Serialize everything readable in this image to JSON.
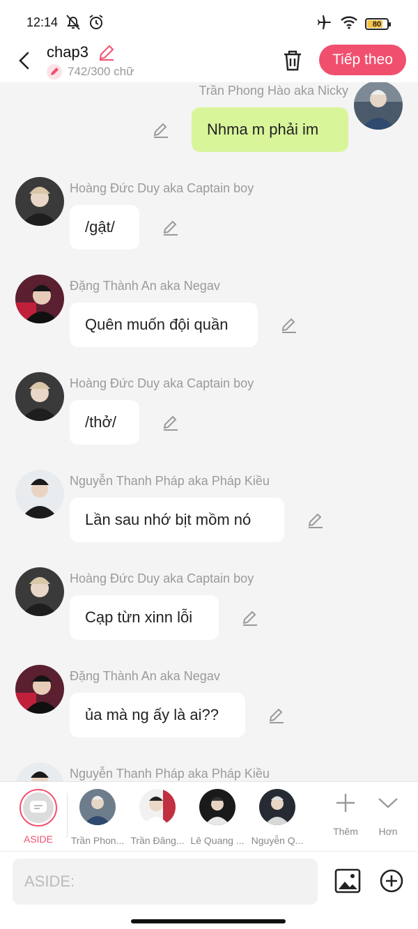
{
  "status": {
    "time": "12:14",
    "battery": "80",
    "battery_level": 0.8
  },
  "header": {
    "title": "chap3",
    "word_count": "742/300 chữ",
    "next_label": "Tiếp theo"
  },
  "messages": [
    {
      "name": "Trần Phong Hào aka Nicky",
      "text": "Nhma m phải im",
      "side": "right"
    },
    {
      "name": "Hoàng Đức Duy aka Captain boy",
      "text": "/gật/",
      "side": "left"
    },
    {
      "name": "Đặng Thành An aka Negav",
      "text": "Quên muốn đội quần",
      "side": "left"
    },
    {
      "name": "Hoàng Đức Duy aka Captain boy",
      "text": "/thở/",
      "side": "left"
    },
    {
      "name": "Nguyễn Thanh Pháp aka Pháp Kiều",
      "text": "Lần sau nhớ bịt mồm nó",
      "side": "left"
    },
    {
      "name": "Hoàng Đức Duy aka Captain boy",
      "text": "Cạp từn xinn lỗi",
      "side": "left"
    },
    {
      "name": "Đặng Thành An aka Negav",
      "text": "ủa mà ng ấy là ai??",
      "side": "left"
    },
    {
      "name": "Nguyễn Thanh Pháp aka Pháp Kiều",
      "text": "",
      "side": "left"
    }
  ],
  "characters": [
    {
      "label": "ASIDE"
    },
    {
      "label": "Trần Phon..."
    },
    {
      "label": "Trần Đăng..."
    },
    {
      "label": "Lê Quang ..."
    },
    {
      "label": "Nguyễn Q..."
    }
  ],
  "tools": {
    "more_label": "Thêm",
    "less_label": "Hơn"
  },
  "input": {
    "placeholder": "ASIDE:"
  },
  "colors": {
    "accent": "#f0506e",
    "my_bubble": "#d9f59a",
    "bubble": "#ffffff",
    "background": "#f4f4f4"
  }
}
